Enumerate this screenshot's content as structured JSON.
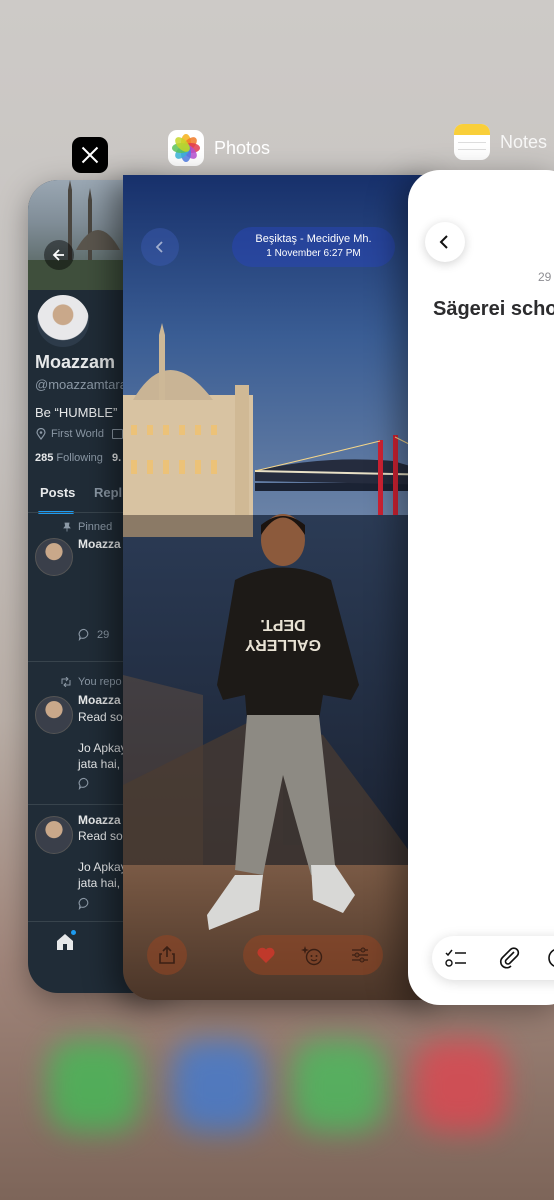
{
  "apps": {
    "x": {
      "icon": "x-logo-icon"
    },
    "photos": {
      "label": "Photos"
    },
    "notes": {
      "label": "Notes"
    }
  },
  "x_profile": {
    "name": "Moazzam",
    "handle": "@moazzamtara",
    "bio": "Be “HUMBLE”",
    "location": "First World",
    "following_count": "285",
    "following_label": "Following",
    "followers_partial": "9.",
    "tabs": [
      "Posts",
      "Repli"
    ],
    "posts": [
      {
        "context": "Pinned",
        "author": "Moazza",
        "reply_count": "29"
      },
      {
        "context": "You repo",
        "author": "Moazza",
        "line1": "Read so",
        "line2": "Jo Apkay",
        "line3": "jata hai,"
      },
      {
        "author": "Moazza",
        "line1": "Read so",
        "line2": "Jo Apkay",
        "line3": "jata hai,"
      }
    ]
  },
  "photo": {
    "location": "Beşiktaş - Mecidiye Mh.",
    "datetime": "1 November   6:27 PM"
  },
  "notes": {
    "date_partial": "29",
    "title_partial": "Sägerei scho"
  },
  "colors": {
    "x_bg": "#202c37",
    "x_accent": "#1d9bf0",
    "photos_pill": "#2846b4",
    "photos_heart": "#c0392b"
  }
}
